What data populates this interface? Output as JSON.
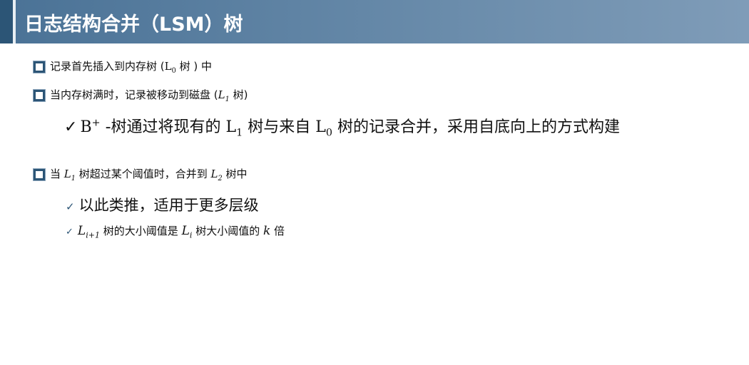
{
  "title": "日志结构合并（LSM）树",
  "bullets": [
    {
      "a": "记录首先插入到内存树 (",
      "m": "L",
      "sub": "0",
      "b": " 树 ) 中"
    },
    {
      "a": "当内存树满时，记录被移动到磁盘 (",
      "m": "L",
      "sub": "1",
      "b": " 树)"
    },
    {
      "check": "✓",
      "m0": "B",
      "sup": "+",
      "a": " -树通过将现有的 ",
      "m": "L",
      "sub": "1",
      "b": " 树与来自 ",
      "m2": "L",
      "sub2": "0",
      "c": " 树的记录合并，采用自底向上的方式构建"
    },
    {
      "a": "当 ",
      "m": "L",
      "sub": "1",
      "b": " 树超过某个阈值时，合并到 ",
      "m2": "L",
      "sub2": "2",
      "c": " 树中"
    },
    {
      "check": "✓",
      "a": "以此类推，适用于更多层级"
    },
    {
      "check": "✓",
      "m": "L",
      "sub": "i+1",
      "a": " 树的大小阈值是 ",
      "m2": "L",
      "sub2": "i",
      "b": " 树大小阈值的 ",
      "k": "k",
      "c": " 倍"
    }
  ]
}
